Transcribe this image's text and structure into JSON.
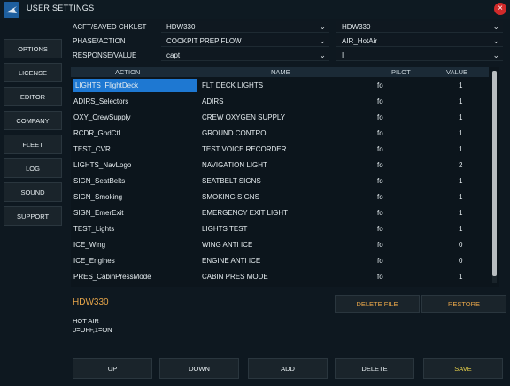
{
  "window": {
    "title": "USER SETTINGS",
    "close_glyph": "×"
  },
  "sidebar": {
    "items": [
      {
        "label": "OPTIONS"
      },
      {
        "label": "LICENSE"
      },
      {
        "label": "EDITOR"
      },
      {
        "label": "COMPANY"
      },
      {
        "label": "FLEET"
      },
      {
        "label": "LOG"
      },
      {
        "label": "SOUND"
      },
      {
        "label": "SUPPORT"
      }
    ]
  },
  "filters": {
    "acft_label": "ACFT/SAVED CHKLST",
    "acft_value": "HDW330",
    "saved_value": "HDW330",
    "phase_label": "PHASE/ACTION",
    "phase_value": "COCKPIT PREP FLOW",
    "action_value": "AIR_HotAir",
    "response_label": "RESPONSE/VALUE",
    "response_value": "capt",
    "value_value": "I"
  },
  "table": {
    "headers": {
      "action": "ACTION",
      "name": "NAME",
      "pilot": "PILOT",
      "value": "VALUE"
    },
    "rows": [
      {
        "action": "LIGHTS_FlightDeck",
        "name": "FLT DECK LIGHTS",
        "pilot": "fo",
        "value": "1"
      },
      {
        "action": "ADIRS_Selectors",
        "name": "ADIRS",
        "pilot": "fo",
        "value": "1"
      },
      {
        "action": "OXY_CrewSupply",
        "name": "CREW OXYGEN SUPPLY",
        "pilot": "fo",
        "value": "1"
      },
      {
        "action": "RCDR_GndCtl",
        "name": "GROUND CONTROL",
        "pilot": "fo",
        "value": "1"
      },
      {
        "action": "TEST_CVR",
        "name": "TEST VOICE RECORDER",
        "pilot": "fo",
        "value": "1"
      },
      {
        "action": "LIGHTS_NavLogo",
        "name": "NAVIGATION LIGHT",
        "pilot": "fo",
        "value": "2"
      },
      {
        "action": "SIGN_SeatBelts",
        "name": "SEATBELT SIGNS",
        "pilot": "fo",
        "value": "1"
      },
      {
        "action": "SIGN_Smoking",
        "name": "SMOKING SIGNS",
        "pilot": "fo",
        "value": "1"
      },
      {
        "action": "SIGN_EmerExit",
        "name": "EMERGENCY EXIT LIGHT",
        "pilot": "fo",
        "value": "1"
      },
      {
        "action": "TEST_Lights",
        "name": "LIGHTS TEST",
        "pilot": "fo",
        "value": "1"
      },
      {
        "action": "ICE_Wing",
        "name": "WING ANTI ICE",
        "pilot": "fo",
        "value": "0"
      },
      {
        "action": "ICE_Engines",
        "name": "ENGINE ANTI ICE",
        "pilot": "fo",
        "value": "0"
      },
      {
        "action": "PRES_CabinPressMode",
        "name": "CABIN PRES MODE",
        "pilot": "fo",
        "value": "1"
      }
    ]
  },
  "details": {
    "selected_name": "HDW330",
    "delete_file_label": "DELETE FILE",
    "restore_label": "RESTORE",
    "description_line1": "HOT AIR",
    "description_line2": "0=OFF,1=ON"
  },
  "actions": {
    "up_label": "UP",
    "down_label": "DOWN",
    "add_label": "ADD",
    "delete_label": "DELETE",
    "save_label": "SAVE"
  },
  "colors": {
    "accent_orange": "#e8a64a",
    "selection_blue": "#1e78d2",
    "save_yellow": "#e8d24a",
    "close_red": "#d02a2a"
  }
}
